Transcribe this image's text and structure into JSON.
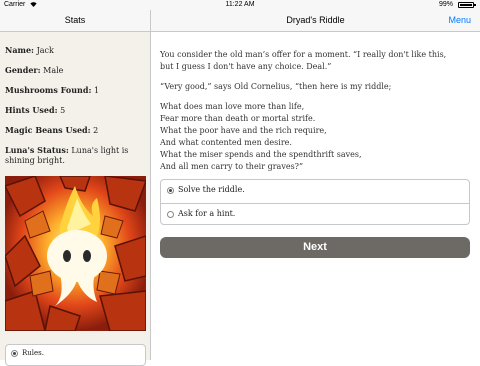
{
  "status_bar": {
    "carrier": "Carrier",
    "time": "11:22 AM",
    "battery": "99%"
  },
  "left_nav": {
    "title": "Stats"
  },
  "right_nav": {
    "title": "Dryad's Riddle",
    "menu_label": "Menu"
  },
  "stats": [
    {
      "label": "Name:",
      "value": "Jack"
    },
    {
      "label": "Gender:",
      "value": "Male"
    },
    {
      "label": "Mushrooms Found:",
      "value": "1"
    },
    {
      "label": "Hints Used:",
      "value": "5"
    },
    {
      "label": "Magic Beans Used:",
      "value": "2"
    },
    {
      "label": "Luna's Status:",
      "value": "Luna's light is shining bright."
    }
  ],
  "rules": {
    "label": "Rules."
  },
  "story": {
    "p1": "You consider the old man’s offer for a moment. “I really don't like this, but I guess I don't have any choice. Deal.”",
    "p2": "“Very good,” says Old Cornelius, “then here is my riddle;",
    "riddle": [
      "What does man love more than life,",
      "Fear more than death or mortal strife.",
      "What the poor have and the rich require,",
      "And what contented men desire.",
      "What the miser spends and the spendthrift saves,",
      "And all men carry to their graves?”"
    ]
  },
  "choices": [
    {
      "label": "Solve the riddle.",
      "selected": true
    },
    {
      "label": "Ask for a hint.",
      "selected": false
    }
  ],
  "next_label": "Next"
}
